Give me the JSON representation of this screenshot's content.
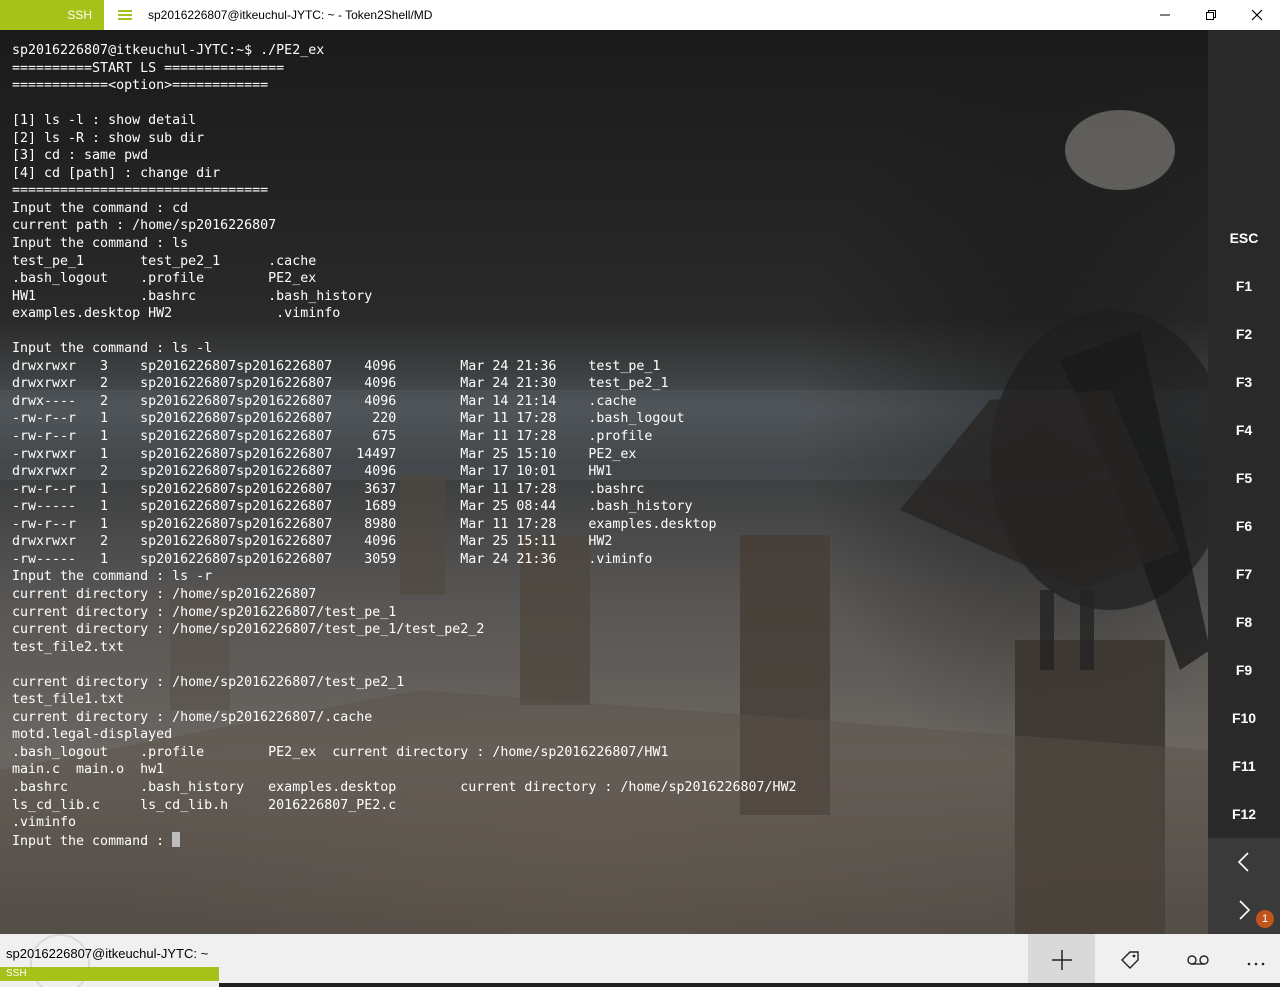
{
  "titlebar": {
    "tag": "SSH",
    "title": "sp2016226807@itkeuchul-JYTC: ~ - Token2Shell/MD",
    "accent_color": "#a6c21a",
    "menu_icon": "hamburger-icon",
    "buttons": [
      "minimize-icon",
      "restore-icon",
      "close-icon"
    ]
  },
  "terminal": {
    "lines": [
      "sp2016226807@itkeuchul-JYTC:~$ ./PE2_ex",
      "==========START LS ===============",
      "============<option>============",
      "",
      "[1] ls -l : show detail",
      "[2] ls -R : show sub dir",
      "[3] cd : same pwd",
      "[4] cd [path] : change dir",
      "================================",
      "Input the command : cd",
      "current path : /home/sp2016226807",
      "Input the command : ls",
      "test_pe_1       test_pe2_1      .cache",
      ".bash_logout    .profile        PE2_ex",
      "HW1             .bashrc         .bash_history",
      "examples.desktop HW2             .viminfo",
      "",
      "Input the command : ls -l",
      "drwxrwxr   3    sp2016226807sp2016226807    4096        Mar 24 21:36    test_pe_1",
      "drwxrwxr   2    sp2016226807sp2016226807    4096        Mar 24 21:30    test_pe2_1",
      "drwx----   2    sp2016226807sp2016226807    4096        Mar 14 21:14    .cache",
      "-rw-r--r   1    sp2016226807sp2016226807     220        Mar 11 17:28    .bash_logout",
      "-rw-r--r   1    sp2016226807sp2016226807     675        Mar 11 17:28    .profile",
      "-rwxrwxr   1    sp2016226807sp2016226807   14497        Mar 25 15:10    PE2_ex",
      "drwxrwxr   2    sp2016226807sp2016226807    4096        Mar 17 10:01    HW1",
      "-rw-r--r   1    sp2016226807sp2016226807    3637        Mar 11 17:28    .bashrc",
      "-rw-----   1    sp2016226807sp2016226807    1689        Mar 25 08:44    .bash_history",
      "-rw-r--r   1    sp2016226807sp2016226807    8980        Mar 11 17:28    examples.desktop",
      "drwxrwxr   2    sp2016226807sp2016226807    4096        Mar 25 15:11    HW2",
      "-rw-----   1    sp2016226807sp2016226807    3059        Mar 24 21:36    .viminfo",
      "Input the command : ls -r",
      "current directory : /home/sp2016226807",
      "current directory : /home/sp2016226807/test_pe_1",
      "current directory : /home/sp2016226807/test_pe_1/test_pe2_2",
      "test_file2.txt",
      "",
      "current directory : /home/sp2016226807/test_pe2_1",
      "test_file1.txt",
      "current directory : /home/sp2016226807/.cache",
      "motd.legal-displayed",
      ".bash_logout    .profile        PE2_ex  current directory : /home/sp2016226807/HW1",
      "main.c  main.o  hw1",
      ".bashrc         .bash_history   examples.desktop        current directory : /home/sp2016226807/HW2",
      "ls_cd_lib.c     ls_cd_lib.h     2016226807_PE2.c",
      ".viminfo",
      "Input the command : "
    ]
  },
  "fkeys": {
    "labels": [
      "ESC",
      "F1",
      "F2",
      "F3",
      "F4",
      "F5",
      "F6",
      "F7",
      "F8",
      "F9",
      "F10",
      "F11",
      "F12"
    ],
    "nav": [
      "chevron-left-icon",
      "chevron-right-icon"
    ],
    "badge": "1"
  },
  "bottombar": {
    "session_title": "sp2016226807@itkeuchul-JYTC: ~",
    "session_tag": "SSH",
    "buttons": [
      "plus-icon",
      "tag-icon",
      "voicemail-icon",
      "more-icon"
    ]
  }
}
